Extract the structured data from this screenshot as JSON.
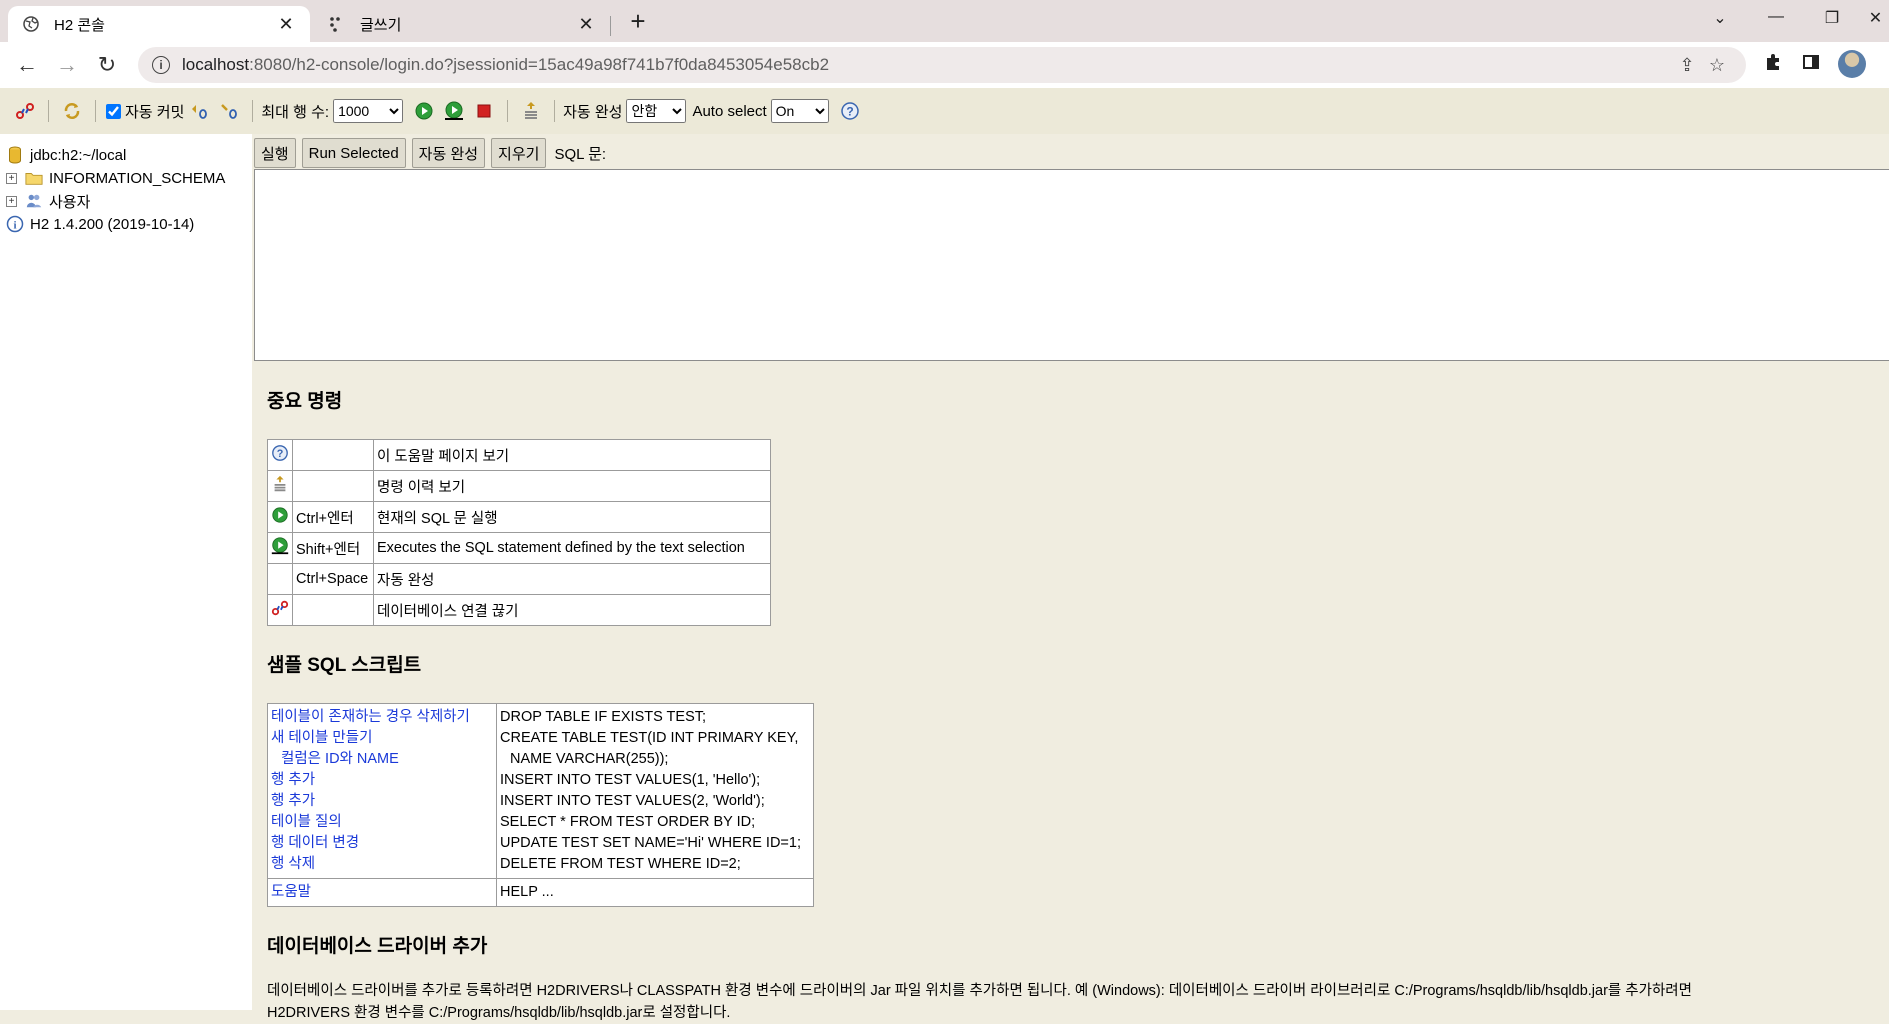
{
  "browser": {
    "tabs": [
      {
        "title": "H2 콘솔",
        "active": true
      },
      {
        "title": "글쓰기",
        "active": false
      }
    ],
    "url_host": "localhost",
    "url_rest": ":8080/h2-console/login.do?jsessionid=15ac49a98f741b7f0da8453054e58cb2"
  },
  "h2toolbar": {
    "autocommit_label": "자동 커밋",
    "autocommit_checked": true,
    "maxrows_label": "최대 행 수:",
    "maxrows_value": "1000",
    "autocomplete_label": "자동 완성",
    "autocomplete_value": "안함",
    "autoselect_label": "Auto select",
    "autoselect_value": "On"
  },
  "tree": {
    "connection": "jdbc:h2:~/local",
    "schema": "INFORMATION_SCHEMA",
    "users": "사용자",
    "version": "H2 1.4.200 (2019-10-14)"
  },
  "query": {
    "run": "실행",
    "run_selected": "Run Selected",
    "autocomplete": "자동 완성",
    "clear": "지우기",
    "sql_label": "SQL 문:"
  },
  "help": {
    "important_title": "중요 명령",
    "commands": [
      {
        "icon": "help-icon",
        "key": "",
        "desc": "이 도움말 페이지 보기"
      },
      {
        "icon": "history-icon",
        "key": "",
        "desc": "명령 이력 보기"
      },
      {
        "icon": "run-icon",
        "key": "Ctrl+엔터",
        "desc": "현재의 SQL 문 실행"
      },
      {
        "icon": "run-selected-icon",
        "key": "Shift+엔터",
        "desc": "Executes the SQL statement defined by the text selection"
      },
      {
        "icon": "",
        "key": "Ctrl+Space",
        "desc": "자동 완성"
      },
      {
        "icon": "disconnect-icon",
        "key": "",
        "desc": "데이터베이스 연결 끊기"
      }
    ],
    "samples_title": "샘플 SQL 스크립트",
    "samples": [
      {
        "label": "테이블이 존재하는 경우 삭제하기",
        "sql": "DROP TABLE IF EXISTS TEST;"
      },
      {
        "label": "새 테이블 만들기",
        "sql": "CREATE TABLE TEST(ID INT PRIMARY KEY,"
      },
      {
        "label": "컬럼은 ID와 NAME",
        "sql": "NAME VARCHAR(255));"
      },
      {
        "label": "행 추가",
        "sql": "INSERT INTO TEST VALUES(1, 'Hello');"
      },
      {
        "label": "행 추가",
        "sql": "INSERT INTO TEST VALUES(2, 'World');"
      },
      {
        "label": "테이블 질의",
        "sql": "SELECT * FROM TEST ORDER BY ID;"
      },
      {
        "label": "행 데이터 변경",
        "sql": "UPDATE TEST SET NAME='Hi' WHERE ID=1;"
      },
      {
        "label": "행 삭제",
        "sql": "DELETE FROM TEST WHERE ID=2;"
      }
    ],
    "help_row": {
      "label": "도움말",
      "sql": "HELP ..."
    },
    "drivers_title": "데이터베이스 드라이버 추가",
    "drivers_text_1": "데이터베이스 드라이버를 추가로 등록하려면 H2DRIVERS나 CLASSPATH 환경 변수에 드라이버의 Jar 파일 위치를 추가하면 됩니다. 예 (Windows): 데이터베이스 드라이버 라이브러리로 C:/Programs/hsqldb/lib/hsqldb.jar를 추가하려면",
    "drivers_text_2": "H2DRIVERS 환경 변수를 C:/Programs/hsqldb/lib/hsqldb.jar로 설정합니다."
  }
}
